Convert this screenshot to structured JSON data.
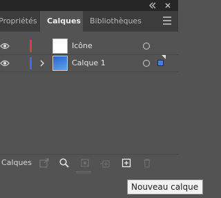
{
  "window": {
    "collapse_icon": "double-chevron-left-icon",
    "close_icon": "close-icon"
  },
  "tabs": [
    {
      "label": "Propriétés",
      "active": false
    },
    {
      "label": "Calques",
      "active": true
    },
    {
      "label": "Bibliothèques",
      "active": false
    }
  ],
  "layers": [
    {
      "name": "Icône",
      "color": "#e23b3b",
      "visible": true,
      "expandable": false,
      "selected": false,
      "thumb_color": "#ffffff"
    },
    {
      "name": "Calque 1",
      "color": "#3b6fe2",
      "visible": true,
      "expandable": true,
      "selected": true,
      "thumb_color": "#4a86e8"
    }
  ],
  "footer": {
    "label": "Calques",
    "icons": [
      "export-icon",
      "search-icon",
      "clipping-mask-icon",
      "new-sublayer-icon",
      "new-layer-icon",
      "trash-icon"
    ]
  },
  "tooltip": {
    "text": "Nouveau calque"
  }
}
